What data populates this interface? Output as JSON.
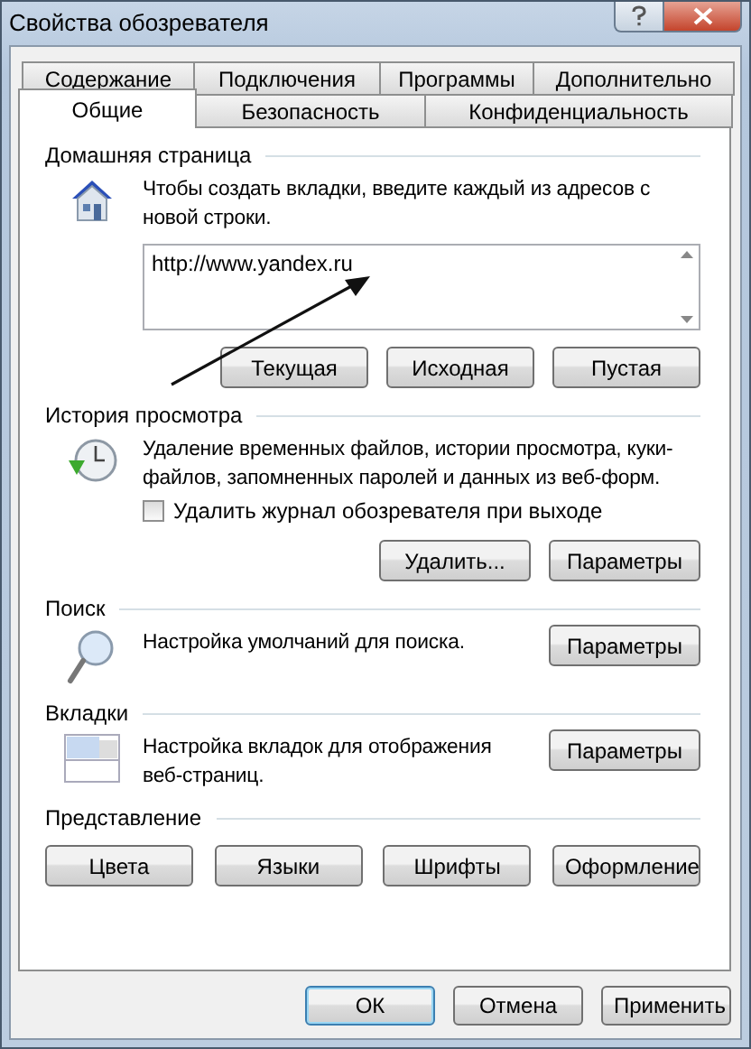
{
  "window": {
    "title": "Свойства обозревателя"
  },
  "tab_rows": [
    [
      {
        "label": "Содержание",
        "selected": false
      },
      {
        "label": "Подключения",
        "selected": false
      },
      {
        "label": "Программы",
        "selected": false
      },
      {
        "label": "Дополнительно",
        "selected": false
      }
    ],
    [
      {
        "label": "Общие",
        "selected": true
      },
      {
        "label": "Безопасность",
        "selected": false
      },
      {
        "label": "Конфиденциальность",
        "selected": false
      }
    ]
  ],
  "home_page": {
    "title": "Домашняя страница",
    "description": "Чтобы создать вкладки, введите каждый из адресов с новой строки.",
    "value": "http://www.yandex.ru",
    "buttons": [
      "Текущая",
      "Исходная",
      "Пустая"
    ]
  },
  "history": {
    "title": "История просмотра",
    "description": "Удаление временных файлов, истории просмотра, куки-файлов, запомненных паролей и данных из веб-форм.",
    "checkbox": {
      "label": "Удалить журнал обозревателя при выходе",
      "checked": false
    },
    "buttons": [
      "Удалить...",
      "Параметры"
    ]
  },
  "search": {
    "title": "Поиск",
    "description": "Настройка умолчаний для поиска.",
    "buttons": [
      "Параметры"
    ]
  },
  "tabs": {
    "title": "Вкладки",
    "description": "Настройка вкладок для отображения веб-страниц.",
    "buttons": [
      "Параметры"
    ]
  },
  "appearance": {
    "title": "Представление",
    "buttons": [
      "Цвета",
      "Языки",
      "Шрифты",
      "Оформление"
    ]
  },
  "footer_buttons": [
    {
      "label": "ОК",
      "default": true
    },
    {
      "label": "Отмена",
      "default": false
    },
    {
      "label": "Применить",
      "default": false
    }
  ]
}
